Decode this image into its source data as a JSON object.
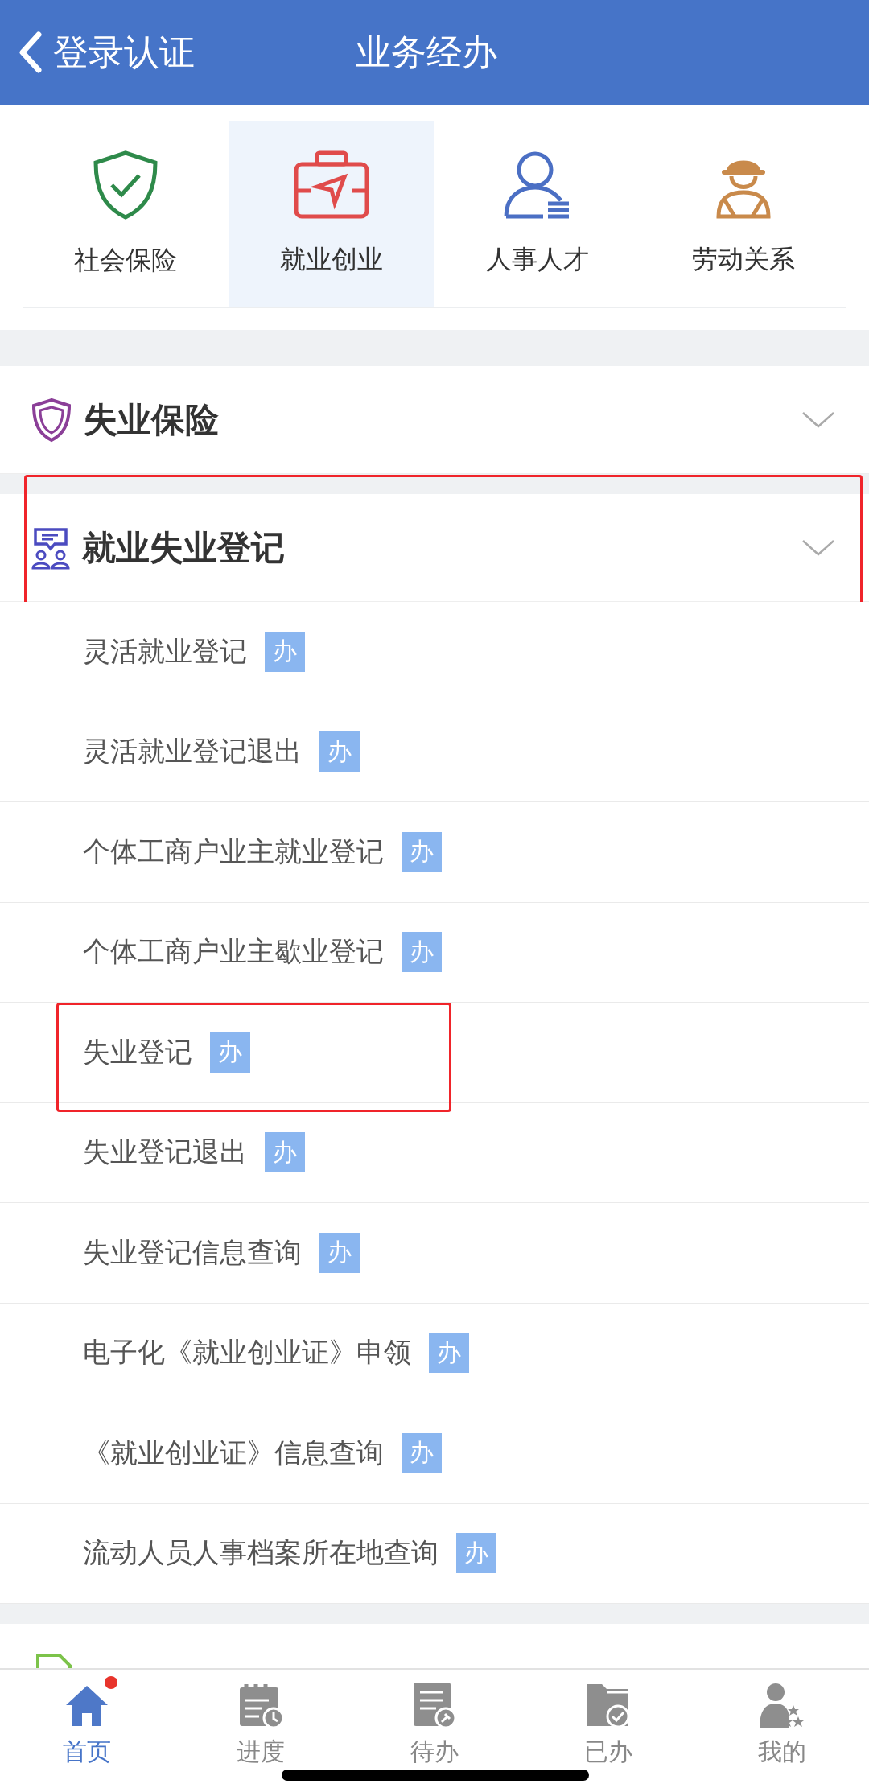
{
  "header": {
    "back_label": "登录认证",
    "title": "业务经办"
  },
  "categories": [
    {
      "label": "社会保险",
      "selected": false
    },
    {
      "label": "就业创业",
      "selected": true
    },
    {
      "label": "人事人才",
      "selected": false
    },
    {
      "label": "劳动关系",
      "selected": false
    }
  ],
  "sections": [
    {
      "title": "失业保险",
      "expanded": false,
      "highlighted": false
    },
    {
      "title": "就业失业登记",
      "expanded": true,
      "highlighted": true,
      "items": [
        {
          "label": "灵活就业登记",
          "badge": "办",
          "highlighted": false
        },
        {
          "label": "灵活就业登记退出",
          "badge": "办",
          "highlighted": false
        },
        {
          "label": "个体工商户业主就业登记",
          "badge": "办",
          "highlighted": false
        },
        {
          "label": "个体工商户业主歇业登记",
          "badge": "办",
          "highlighted": false
        },
        {
          "label": "失业登记",
          "badge": "办",
          "highlighted": true
        },
        {
          "label": "失业登记退出",
          "badge": "办",
          "highlighted": false
        },
        {
          "label": "失业登记信息查询",
          "badge": "办",
          "highlighted": false
        },
        {
          "label": "电子化《就业创业证》申领",
          "badge": "办",
          "highlighted": false
        },
        {
          "label": "《就业创业证》信息查询",
          "badge": "办",
          "highlighted": false
        },
        {
          "label": "流动人员人事档案所在地查询",
          "badge": "办",
          "highlighted": false
        }
      ]
    }
  ],
  "tab_bar": [
    {
      "label": "首页",
      "selected": true,
      "dot": true
    },
    {
      "label": "进度",
      "selected": false,
      "dot": false
    },
    {
      "label": "待办",
      "selected": false,
      "dot": false
    },
    {
      "label": "已办",
      "selected": false,
      "dot": false
    },
    {
      "label": "我的",
      "selected": false,
      "dot": false
    }
  ]
}
